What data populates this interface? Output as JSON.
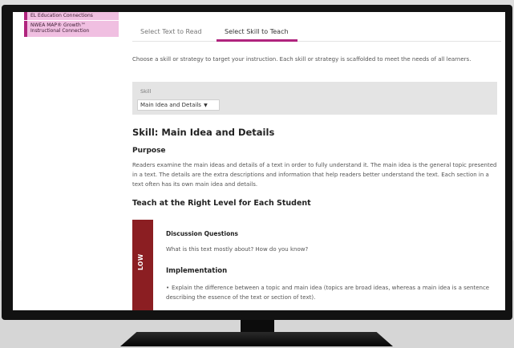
{
  "sidebar": {
    "items": [
      {
        "label": "EL Education Connections"
      },
      {
        "label": "NWEA MAP® Growth™ Instructional Connection"
      }
    ]
  },
  "tabs": [
    {
      "label": "Select Text to Read"
    },
    {
      "label": "Select Skill to Teach"
    }
  ],
  "intro": "Choose a skill or strategy to target your instruction. Each skill or strategy is scaffolded to meet the needs of all learners.",
  "skill_selector": {
    "label": "Skill",
    "selected": "Main Idea and Details",
    "caret": "▼"
  },
  "skill_heading": "Skill: Main Idea and Details",
  "purpose": {
    "heading": "Purpose",
    "text": "Readers examine the main ideas and details of a text in order to fully understand it. The main idea is the general topic presented in a text. The details are the extra descriptions and information that help readers better understand the text. Each section in a text often has its own main idea and details."
  },
  "teach": {
    "heading": "Teach at the Right Level for Each Student",
    "level_label": "LOW",
    "discussion_heading": "Discussion Questions",
    "discussion_text": "What is this text mostly about? How do you know?",
    "implementation_heading": "Implementation",
    "implementation_items": [
      "Explain the difference between a topic and main idea (topics are broad ideas, whereas a main idea is a sentence describing the essence of the text or section of text)."
    ]
  },
  "colors": {
    "accent": "#b0247e",
    "sidebar_bg": "#f0bfe1",
    "low_level": "#8b1e22",
    "skill_box_bg": "#e4e4e4",
    "monitor_bezel": "#121212"
  }
}
